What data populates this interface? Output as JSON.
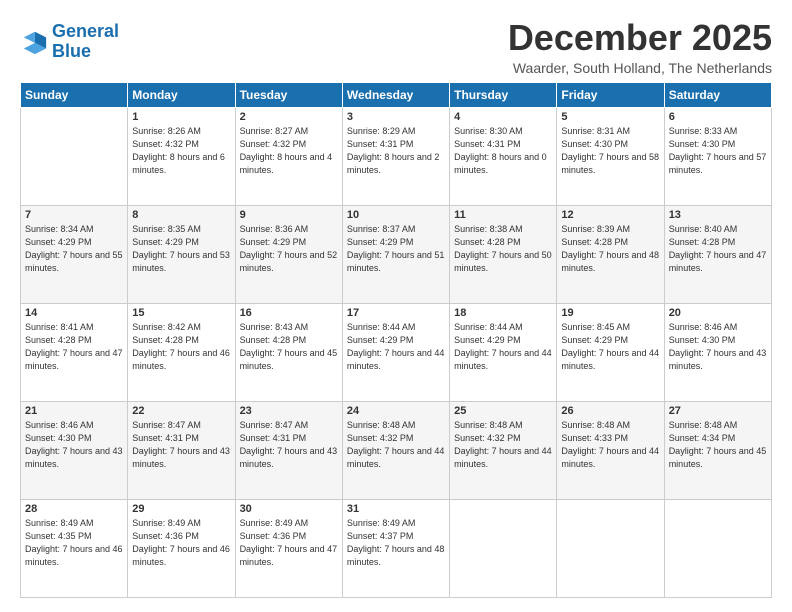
{
  "logo": {
    "line1": "General",
    "line2": "Blue"
  },
  "title": "December 2025",
  "location": "Waarder, South Holland, The Netherlands",
  "days_header": [
    "Sunday",
    "Monday",
    "Tuesday",
    "Wednesday",
    "Thursday",
    "Friday",
    "Saturday"
  ],
  "weeks": [
    [
      {
        "day": "",
        "sunrise": "",
        "sunset": "",
        "daylight": ""
      },
      {
        "day": "1",
        "sunrise": "Sunrise: 8:26 AM",
        "sunset": "Sunset: 4:32 PM",
        "daylight": "Daylight: 8 hours and 6 minutes."
      },
      {
        "day": "2",
        "sunrise": "Sunrise: 8:27 AM",
        "sunset": "Sunset: 4:32 PM",
        "daylight": "Daylight: 8 hours and 4 minutes."
      },
      {
        "day": "3",
        "sunrise": "Sunrise: 8:29 AM",
        "sunset": "Sunset: 4:31 PM",
        "daylight": "Daylight: 8 hours and 2 minutes."
      },
      {
        "day": "4",
        "sunrise": "Sunrise: 8:30 AM",
        "sunset": "Sunset: 4:31 PM",
        "daylight": "Daylight: 8 hours and 0 minutes."
      },
      {
        "day": "5",
        "sunrise": "Sunrise: 8:31 AM",
        "sunset": "Sunset: 4:30 PM",
        "daylight": "Daylight: 7 hours and 58 minutes."
      },
      {
        "day": "6",
        "sunrise": "Sunrise: 8:33 AM",
        "sunset": "Sunset: 4:30 PM",
        "daylight": "Daylight: 7 hours and 57 minutes."
      }
    ],
    [
      {
        "day": "7",
        "sunrise": "Sunrise: 8:34 AM",
        "sunset": "Sunset: 4:29 PM",
        "daylight": "Daylight: 7 hours and 55 minutes."
      },
      {
        "day": "8",
        "sunrise": "Sunrise: 8:35 AM",
        "sunset": "Sunset: 4:29 PM",
        "daylight": "Daylight: 7 hours and 53 minutes."
      },
      {
        "day": "9",
        "sunrise": "Sunrise: 8:36 AM",
        "sunset": "Sunset: 4:29 PM",
        "daylight": "Daylight: 7 hours and 52 minutes."
      },
      {
        "day": "10",
        "sunrise": "Sunrise: 8:37 AM",
        "sunset": "Sunset: 4:29 PM",
        "daylight": "Daylight: 7 hours and 51 minutes."
      },
      {
        "day": "11",
        "sunrise": "Sunrise: 8:38 AM",
        "sunset": "Sunset: 4:28 PM",
        "daylight": "Daylight: 7 hours and 50 minutes."
      },
      {
        "day": "12",
        "sunrise": "Sunrise: 8:39 AM",
        "sunset": "Sunset: 4:28 PM",
        "daylight": "Daylight: 7 hours and 48 minutes."
      },
      {
        "day": "13",
        "sunrise": "Sunrise: 8:40 AM",
        "sunset": "Sunset: 4:28 PM",
        "daylight": "Daylight: 7 hours and 47 minutes."
      }
    ],
    [
      {
        "day": "14",
        "sunrise": "Sunrise: 8:41 AM",
        "sunset": "Sunset: 4:28 PM",
        "daylight": "Daylight: 7 hours and 47 minutes."
      },
      {
        "day": "15",
        "sunrise": "Sunrise: 8:42 AM",
        "sunset": "Sunset: 4:28 PM",
        "daylight": "Daylight: 7 hours and 46 minutes."
      },
      {
        "day": "16",
        "sunrise": "Sunrise: 8:43 AM",
        "sunset": "Sunset: 4:28 PM",
        "daylight": "Daylight: 7 hours and 45 minutes."
      },
      {
        "day": "17",
        "sunrise": "Sunrise: 8:44 AM",
        "sunset": "Sunset: 4:29 PM",
        "daylight": "Daylight: 7 hours and 44 minutes."
      },
      {
        "day": "18",
        "sunrise": "Sunrise: 8:44 AM",
        "sunset": "Sunset: 4:29 PM",
        "daylight": "Daylight: 7 hours and 44 minutes."
      },
      {
        "day": "19",
        "sunrise": "Sunrise: 8:45 AM",
        "sunset": "Sunset: 4:29 PM",
        "daylight": "Daylight: 7 hours and 44 minutes."
      },
      {
        "day": "20",
        "sunrise": "Sunrise: 8:46 AM",
        "sunset": "Sunset: 4:30 PM",
        "daylight": "Daylight: 7 hours and 43 minutes."
      }
    ],
    [
      {
        "day": "21",
        "sunrise": "Sunrise: 8:46 AM",
        "sunset": "Sunset: 4:30 PM",
        "daylight": "Daylight: 7 hours and 43 minutes."
      },
      {
        "day": "22",
        "sunrise": "Sunrise: 8:47 AM",
        "sunset": "Sunset: 4:31 PM",
        "daylight": "Daylight: 7 hours and 43 minutes."
      },
      {
        "day": "23",
        "sunrise": "Sunrise: 8:47 AM",
        "sunset": "Sunset: 4:31 PM",
        "daylight": "Daylight: 7 hours and 43 minutes."
      },
      {
        "day": "24",
        "sunrise": "Sunrise: 8:48 AM",
        "sunset": "Sunset: 4:32 PM",
        "daylight": "Daylight: 7 hours and 44 minutes."
      },
      {
        "day": "25",
        "sunrise": "Sunrise: 8:48 AM",
        "sunset": "Sunset: 4:32 PM",
        "daylight": "Daylight: 7 hours and 44 minutes."
      },
      {
        "day": "26",
        "sunrise": "Sunrise: 8:48 AM",
        "sunset": "Sunset: 4:33 PM",
        "daylight": "Daylight: 7 hours and 44 minutes."
      },
      {
        "day": "27",
        "sunrise": "Sunrise: 8:48 AM",
        "sunset": "Sunset: 4:34 PM",
        "daylight": "Daylight: 7 hours and 45 minutes."
      }
    ],
    [
      {
        "day": "28",
        "sunrise": "Sunrise: 8:49 AM",
        "sunset": "Sunset: 4:35 PM",
        "daylight": "Daylight: 7 hours and 46 minutes."
      },
      {
        "day": "29",
        "sunrise": "Sunrise: 8:49 AM",
        "sunset": "Sunset: 4:36 PM",
        "daylight": "Daylight: 7 hours and 46 minutes."
      },
      {
        "day": "30",
        "sunrise": "Sunrise: 8:49 AM",
        "sunset": "Sunset: 4:36 PM",
        "daylight": "Daylight: 7 hours and 47 minutes."
      },
      {
        "day": "31",
        "sunrise": "Sunrise: 8:49 AM",
        "sunset": "Sunset: 4:37 PM",
        "daylight": "Daylight: 7 hours and 48 minutes."
      },
      {
        "day": "",
        "sunrise": "",
        "sunset": "",
        "daylight": ""
      },
      {
        "day": "",
        "sunrise": "",
        "sunset": "",
        "daylight": ""
      },
      {
        "day": "",
        "sunrise": "",
        "sunset": "",
        "daylight": ""
      }
    ]
  ]
}
